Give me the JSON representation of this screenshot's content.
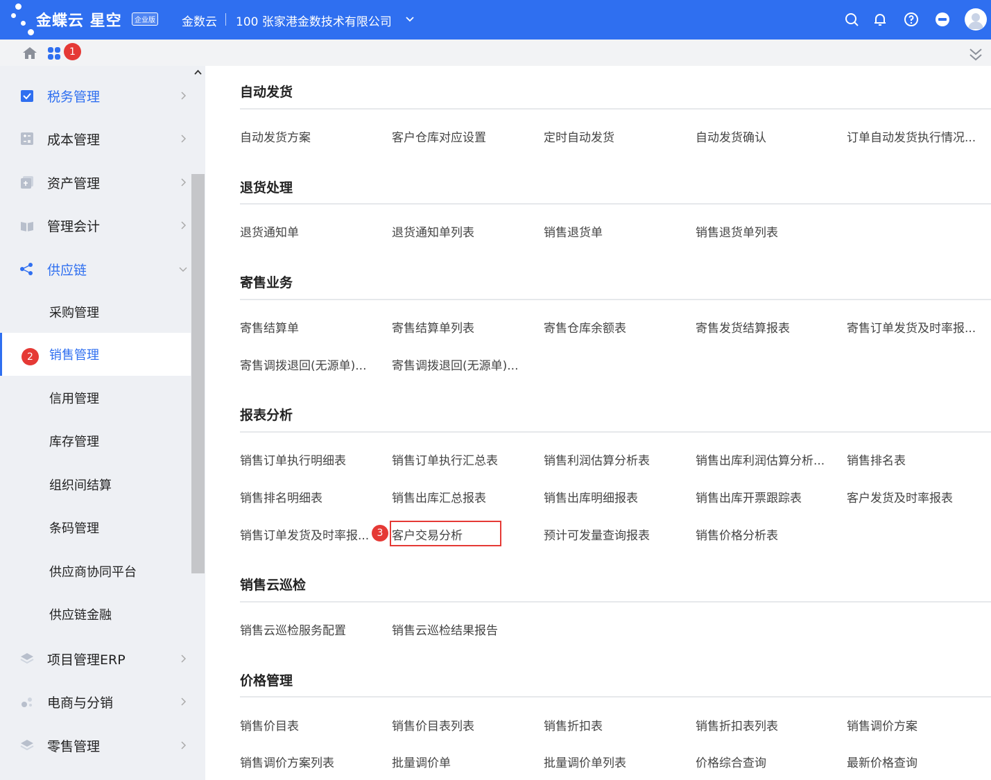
{
  "header": {
    "logo_text": "金蝶云 星空",
    "logo_badge": "企业版",
    "brand": "金数云",
    "company": "100 张家港金数技术有限公司"
  },
  "subbar": {
    "badge_apps": "1"
  },
  "sidebar": {
    "items": [
      {
        "label": "税务管理"
      },
      {
        "label": "成本管理"
      },
      {
        "label": "资产管理"
      },
      {
        "label": "管理会计"
      },
      {
        "label": "供应链"
      },
      {
        "label": "项目管理ERP"
      },
      {
        "label": "电商与分销"
      },
      {
        "label": "零售管理"
      }
    ],
    "sub_items": [
      {
        "label": "采购管理"
      },
      {
        "label": "销售管理"
      },
      {
        "label": "信用管理"
      },
      {
        "label": "库存管理"
      },
      {
        "label": "组织间结算"
      },
      {
        "label": "条码管理"
      },
      {
        "label": "供应商协同平台"
      },
      {
        "label": "供应链金融"
      }
    ],
    "badge_sales": "2"
  },
  "sections": [
    {
      "title": "自动发货",
      "links": [
        "自动发货方案",
        "客户仓库对应设置",
        "定时自动发货",
        "自动发货确认",
        "订单自动发货执行情况..."
      ]
    },
    {
      "title": "退货处理",
      "links": [
        "退货通知单",
        "退货通知单列表",
        "销售退货单",
        "销售退货单列表"
      ]
    },
    {
      "title": "寄售业务",
      "links": [
        "寄售结算单",
        "寄售结算单列表",
        "寄售仓库余额表",
        "寄售发货结算报表",
        "寄售订单发货及时率报...",
        "寄售调拨退回(无源单)...",
        "寄售调拨退回(无源单)..."
      ]
    },
    {
      "title": "报表分析",
      "links": [
        "销售订单执行明细表",
        "销售订单执行汇总表",
        "销售利润估算分析表",
        "销售出库利润估算分析...",
        "销售排名表",
        "销售排名明细表",
        "销售出库汇总报表",
        "销售出库明细报表",
        "销售出库开票跟踪表",
        "客户发货及时率报表",
        "销售订单发货及时率报...",
        "客户交易分析",
        "预计可发量查询报表",
        "销售价格分析表"
      ]
    },
    {
      "title": "销售云巡检",
      "links": [
        "销售云巡检服务配置",
        "销售云巡检结果报告"
      ]
    },
    {
      "title": "价格管理",
      "links": [
        "销售价目表",
        "销售价目表列表",
        "销售折扣表",
        "销售折扣表列表",
        "销售调价方案",
        "销售调价方案列表",
        "批量调价单",
        "批量调价单列表",
        "价格综合查询",
        "最新价格查询"
      ]
    }
  ],
  "badge_customer": "3"
}
